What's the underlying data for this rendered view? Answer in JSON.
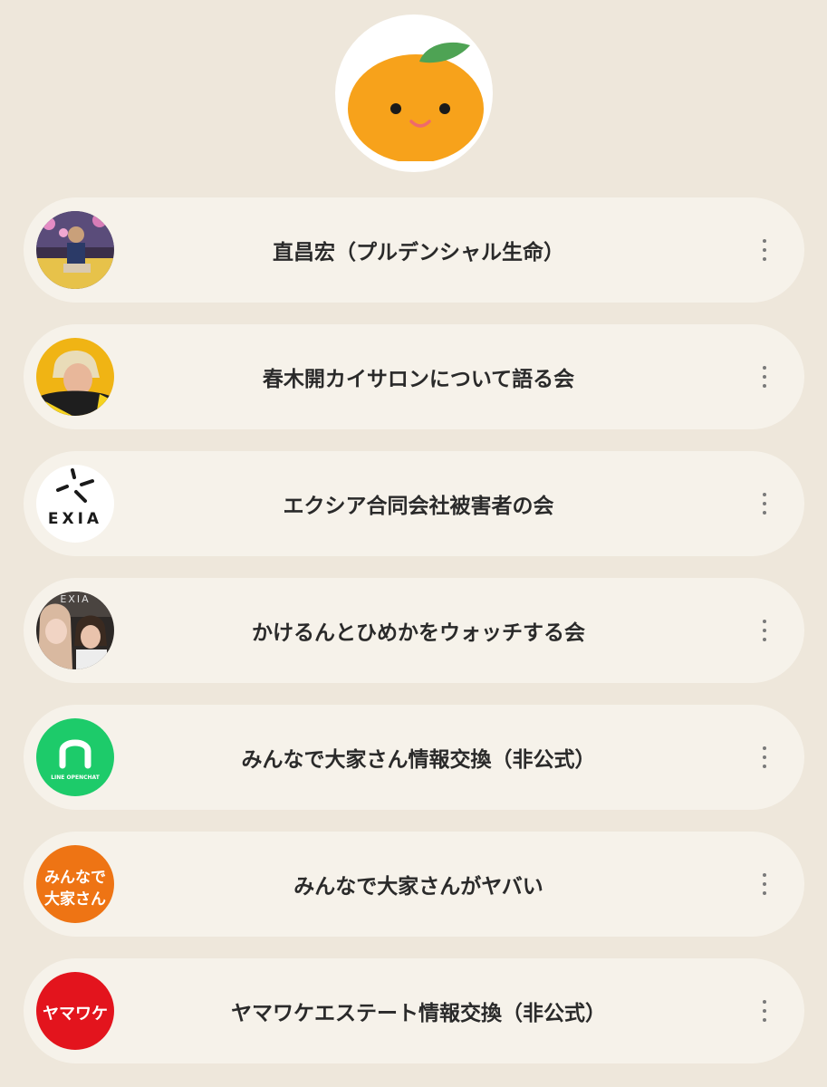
{
  "logo": {
    "icon": "mandarin-orange-face-icon"
  },
  "chats": [
    {
      "name": "直昌宏（プルデンシャル生命）",
      "avatar": "person-photo",
      "more_icon": "more-vertical-icon"
    },
    {
      "name": "春木開カイサロンについて語る会",
      "avatar": "person-photo-yellow",
      "more_icon": "more-vertical-icon"
    },
    {
      "name": "エクシア合同会社被害者の会",
      "avatar": "exia-logo",
      "avatar_text": "EXIA",
      "more_icon": "more-vertical-icon"
    },
    {
      "name": "かけるんとひめかをウォッチする会",
      "avatar": "couple-photo",
      "avatar_text": "EXIA",
      "more_icon": "more-vertical-icon"
    },
    {
      "name": "みんなで大家さん情報交換（非公式）",
      "avatar": "line-openchat-logo",
      "avatar_text": "LINE OPENCHAT",
      "more_icon": "more-vertical-icon"
    },
    {
      "name": "みんなで大家さんがヤバい",
      "avatar": "minnade-ooyasan-logo",
      "avatar_text_1": "みんなで",
      "avatar_text_2": "大家さん",
      "more_icon": "more-vertical-icon"
    },
    {
      "name": "ヤマワケエステート情報交換（非公式）",
      "avatar": "yamawake-logo",
      "avatar_text": "ヤマワケ",
      "more_icon": "more-vertical-icon"
    }
  ],
  "colors": {
    "background": "#EEE7DB",
    "card": "#F6F2EA",
    "orange": "#F7A21B",
    "leaf": "#4EA354",
    "line_green": "#1DCB6A",
    "minnade_orange": "#EE7414",
    "yamawake_red": "#E3141D"
  }
}
